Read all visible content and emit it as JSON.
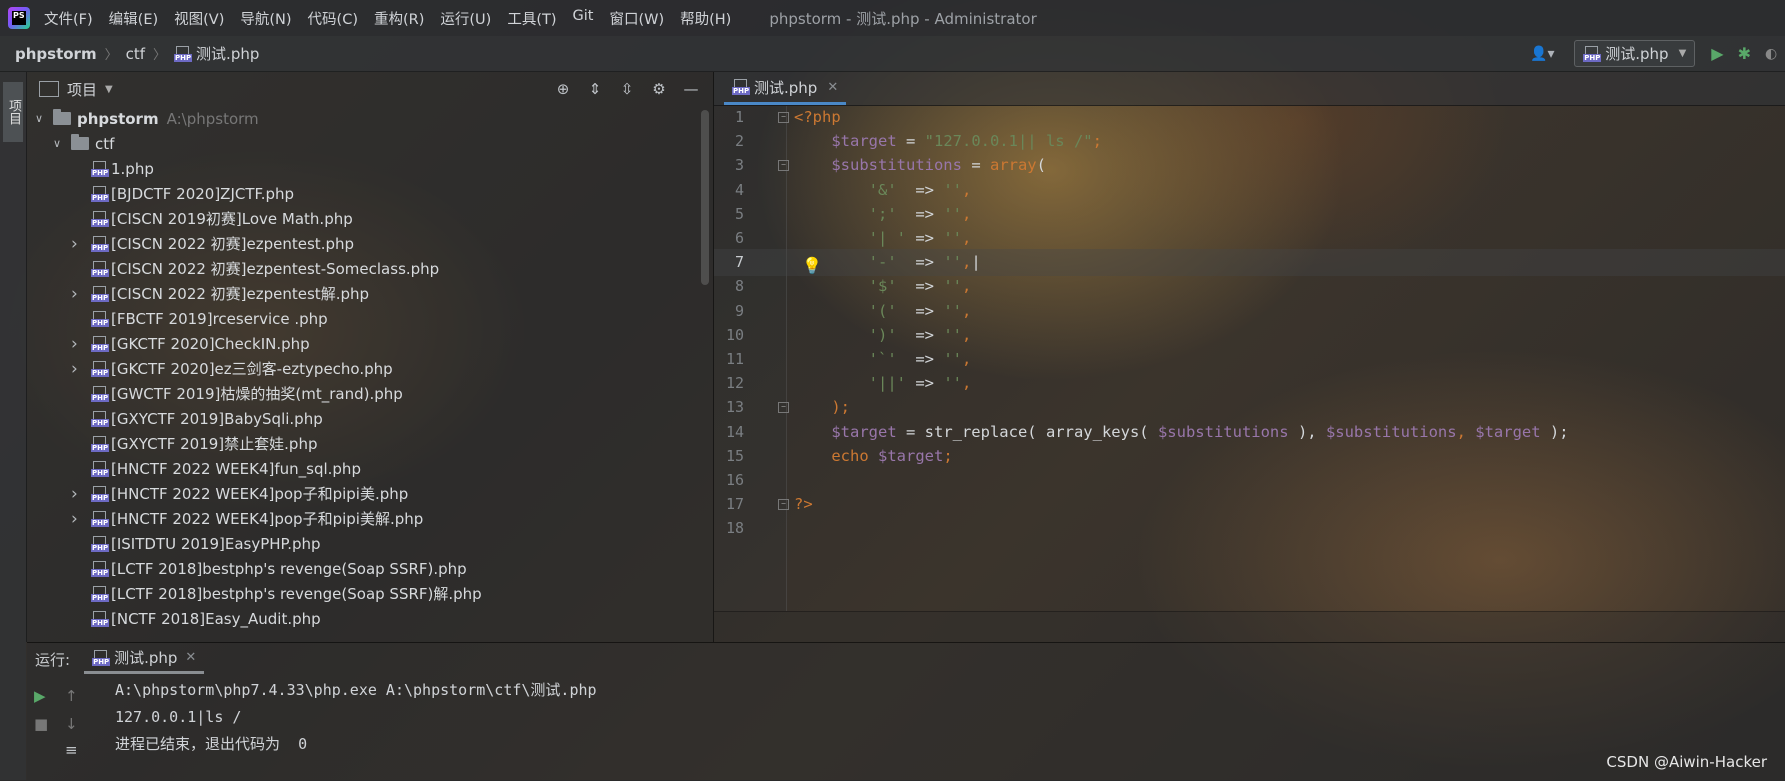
{
  "menu": {
    "items": [
      "文件(F)",
      "编辑(E)",
      "视图(V)",
      "导航(N)",
      "代码(C)",
      "重构(R)",
      "运行(U)",
      "工具(T)",
      "Git",
      "窗口(W)",
      "帮助(H)"
    ],
    "window_title": "phpstorm - 测试.php - Administrator"
  },
  "breadcrumb": {
    "project": "phpstorm",
    "folder": "ctf",
    "file": "测试.php"
  },
  "run_config": {
    "label": "测试.php"
  },
  "side_tab": "项目",
  "project_panel": {
    "title": "项目",
    "root": {
      "name": "phpstorm",
      "path": "A:\\phpstorm"
    },
    "folder": "ctf",
    "files": [
      {
        "name": "1.php",
        "expandable": false
      },
      {
        "name": "[BJDCTF 2020]ZJCTF.php",
        "expandable": false
      },
      {
        "name": "[CISCN 2019初赛]Love Math.php",
        "expandable": false
      },
      {
        "name": "[CISCN 2022 初赛]ezpentest.php",
        "expandable": true
      },
      {
        "name": "[CISCN 2022 初赛]ezpentest-Someclass.php",
        "expandable": false
      },
      {
        "name": "[CISCN 2022 初赛]ezpentest解.php",
        "expandable": true
      },
      {
        "name": "[FBCTF 2019]rceservice .php",
        "expandable": false
      },
      {
        "name": "[GKCTF 2020]CheckIN.php",
        "expandable": true
      },
      {
        "name": "[GKCTF 2020]ez三剑客-eztypecho.php",
        "expandable": true
      },
      {
        "name": "[GWCTF 2019]枯燥的抽奖(mt_rand).php",
        "expandable": false
      },
      {
        "name": "[GXYCTF 2019]BabySqli.php",
        "expandable": false
      },
      {
        "name": "[GXYCTF 2019]禁止套娃.php",
        "expandable": false
      },
      {
        "name": "[HNCTF 2022 WEEK4]fun_sql.php",
        "expandable": false
      },
      {
        "name": "[HNCTF 2022 WEEK4]pop子和pipi美.php",
        "expandable": true
      },
      {
        "name": "[HNCTF 2022 WEEK4]pop子和pipi美解.php",
        "expandable": true
      },
      {
        "name": "[ISITDTU 2019]EasyPHP.php",
        "expandable": false
      },
      {
        "name": "[LCTF 2018]bestphp's revenge(Soap SSRF).php",
        "expandable": false
      },
      {
        "name": "[LCTF 2018]bestphp's revenge(Soap SSRF)解.php",
        "expandable": false
      },
      {
        "name": "[NCTF 2018]Easy_Audit.php",
        "expandable": false
      }
    ]
  },
  "editor": {
    "tab": "测试.php",
    "current_line": 7,
    "lines": [
      {
        "n": "1",
        "tokens": [
          {
            "t": "<?php",
            "c": "kw"
          }
        ]
      },
      {
        "n": "2",
        "tokens": [
          {
            "t": "    "
          },
          {
            "t": "$target",
            "c": "var"
          },
          {
            "t": " = "
          },
          {
            "t": "\"127.0.0.1|| ls /\"",
            "c": "str"
          },
          {
            "t": ";",
            "c": "kw"
          }
        ]
      },
      {
        "n": "3",
        "tokens": [
          {
            "t": "    "
          },
          {
            "t": "$substitutions",
            "c": "var"
          },
          {
            "t": " = "
          },
          {
            "t": "array",
            "c": "kw"
          },
          {
            "t": "("
          }
        ]
      },
      {
        "n": "4",
        "tokens": [
          {
            "t": "        "
          },
          {
            "t": "'&'",
            "c": "str"
          },
          {
            "t": "  => "
          },
          {
            "t": "''",
            "c": "str"
          },
          {
            "t": ",",
            "c": "kw"
          }
        ]
      },
      {
        "n": "5",
        "tokens": [
          {
            "t": "        "
          },
          {
            "t": "';'",
            "c": "str"
          },
          {
            "t": "  => "
          },
          {
            "t": "''",
            "c": "str"
          },
          {
            "t": ",",
            "c": "kw"
          }
        ]
      },
      {
        "n": "6",
        "tokens": [
          {
            "t": "        "
          },
          {
            "t": "'| '",
            "c": "str"
          },
          {
            "t": " => "
          },
          {
            "t": "''",
            "c": "str"
          },
          {
            "t": ",",
            "c": "kw"
          }
        ]
      },
      {
        "n": "7",
        "tokens": [
          {
            "t": "        "
          },
          {
            "t": "'-'",
            "c": "str"
          },
          {
            "t": "  => "
          },
          {
            "t": "''",
            "c": "str"
          },
          {
            "t": ",",
            "c": "kw"
          },
          {
            "t": "|"
          }
        ]
      },
      {
        "n": "8",
        "tokens": [
          {
            "t": "        "
          },
          {
            "t": "'$'",
            "c": "str"
          },
          {
            "t": "  => "
          },
          {
            "t": "''",
            "c": "str"
          },
          {
            "t": ",",
            "c": "kw"
          }
        ]
      },
      {
        "n": "9",
        "tokens": [
          {
            "t": "        "
          },
          {
            "t": "'('",
            "c": "str"
          },
          {
            "t": "  => "
          },
          {
            "t": "''",
            "c": "str"
          },
          {
            "t": ",",
            "c": "kw"
          }
        ]
      },
      {
        "n": "10",
        "tokens": [
          {
            "t": "        "
          },
          {
            "t": "')'",
            "c": "str"
          },
          {
            "t": "  => "
          },
          {
            "t": "''",
            "c": "str"
          },
          {
            "t": ",",
            "c": "kw"
          }
        ]
      },
      {
        "n": "11",
        "tokens": [
          {
            "t": "        "
          },
          {
            "t": "'`'",
            "c": "str"
          },
          {
            "t": "  => "
          },
          {
            "t": "''",
            "c": "str"
          },
          {
            "t": ",",
            "c": "kw"
          }
        ]
      },
      {
        "n": "12",
        "tokens": [
          {
            "t": "        "
          },
          {
            "t": "'||'",
            "c": "str"
          },
          {
            "t": " => "
          },
          {
            "t": "''",
            "c": "str"
          },
          {
            "t": ",",
            "c": "kw"
          }
        ]
      },
      {
        "n": "13",
        "tokens": [
          {
            "t": "    "
          },
          {
            "t": ");",
            "c": "kw"
          }
        ]
      },
      {
        "n": "14",
        "tokens": [
          {
            "t": "    "
          },
          {
            "t": "$target",
            "c": "var"
          },
          {
            "t": " = str_replace( array_keys( "
          },
          {
            "t": "$substitutions",
            "c": "var"
          },
          {
            "t": " ), "
          },
          {
            "t": "$substitutions",
            "c": "var"
          },
          {
            "t": ", ",
            "c": "kw"
          },
          {
            "t": "$target",
            "c": "var"
          },
          {
            "t": " );"
          }
        ]
      },
      {
        "n": "15",
        "tokens": [
          {
            "t": "    "
          },
          {
            "t": "echo",
            "c": "kw"
          },
          {
            "t": " "
          },
          {
            "t": "$target",
            "c": "var"
          },
          {
            "t": ";",
            "c": "kw"
          }
        ]
      },
      {
        "n": "16",
        "tokens": []
      },
      {
        "n": "17",
        "tokens": [
          {
            "t": "?>",
            "c": "kw"
          }
        ]
      },
      {
        "n": "18",
        "tokens": []
      }
    ]
  },
  "run_panel": {
    "label": "运行:",
    "tab": "测试.php",
    "output": [
      "A:\\phpstorm\\php7.4.33\\php.exe A:\\phpstorm\\ctf\\测试.php",
      "127.0.0.1|ls /",
      "进程已结束，退出代码为  0"
    ]
  },
  "watermark": "CSDN @Aiwin-Hacker"
}
